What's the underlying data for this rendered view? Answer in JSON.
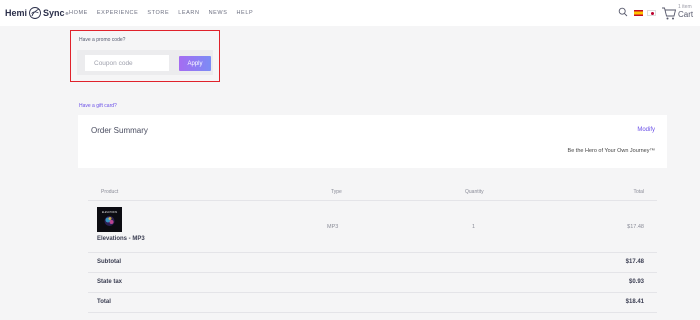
{
  "header": {
    "logo_text_1": "Hemi",
    "logo_text_2": "Sync",
    "logo_tm": "®",
    "nav": [
      "HOME",
      "EXPERIENCE",
      "STORE",
      "LEARN",
      "NEWS",
      "HELP"
    ],
    "cart_count": "1 item",
    "cart_label": "Cart"
  },
  "promo": {
    "title": "Have a promo code?",
    "placeholder": "Coupon code",
    "apply_label": "Apply"
  },
  "gift_card_link": "Have a gift card?",
  "summary": {
    "title": "Order Summary",
    "modify_label": "Modify",
    "subtitle": "Be the Hero of Your Own Journey™"
  },
  "table": {
    "headers": {
      "product": "Product",
      "type": "Type",
      "quantity": "Quantity",
      "total": "Total"
    },
    "item": {
      "name": "Elevations - MP3",
      "image_caption": "ELEVATIONS",
      "type": "MP3",
      "quantity": "1",
      "total": "$17.48"
    },
    "subtotal_label": "Subtotal",
    "subtotal": "$17.48",
    "tax_label": "State tax",
    "tax": "$0.93",
    "total_label": "Total",
    "total": "$18.41"
  },
  "colors": {
    "accent": "#6a4fe8",
    "highlight_border": "#e0222b"
  }
}
